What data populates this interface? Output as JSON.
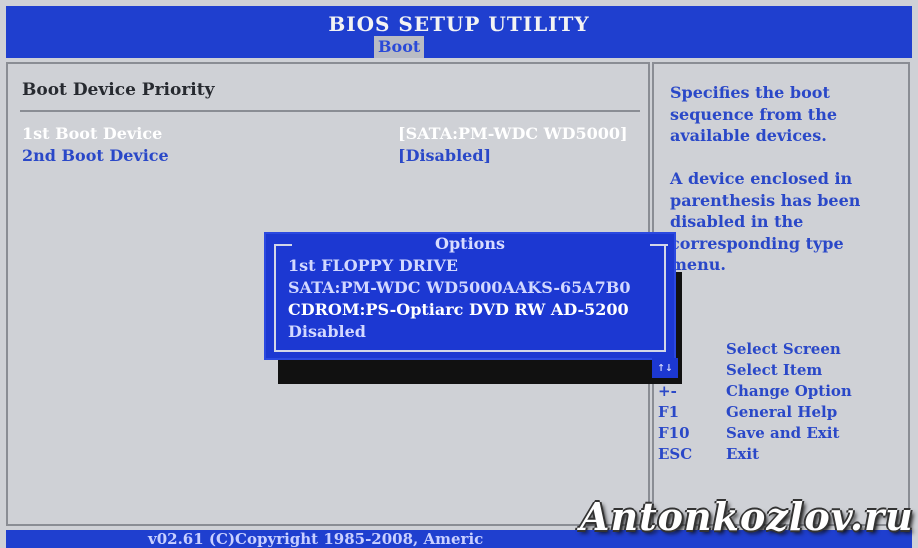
{
  "header": {
    "title": "BIOS SETUP UTILITY",
    "active_tab": "Boot"
  },
  "main": {
    "section_title": "Boot Device Priority",
    "rows": [
      {
        "label": "1st Boot Device",
        "value": "[SATA:PM-WDC WD5000]"
      },
      {
        "label": "2nd Boot Device",
        "value": "[Disabled]"
      }
    ]
  },
  "dialog": {
    "title": "Options",
    "options": [
      "1st FLOPPY DRIVE",
      "SATA:PM-WDC WD5000AAKS-65A7B0",
      "CDROM:PS-Optiarc DVD RW AD-5200",
      "Disabled"
    ],
    "selected_index": 2
  },
  "help": {
    "lines_1": [
      "Specifies the boot",
      "sequence from the",
      "available devices."
    ],
    "lines_2": [
      "A device enclosed in",
      "parenthesis has been",
      "disabled in the",
      "corresponding type",
      "menu."
    ],
    "keys": [
      {
        "key": "",
        "desc": "Select Screen"
      },
      {
        "key": "↑↓",
        "desc": "Select Item"
      },
      {
        "key": "+-",
        "desc": "Change Option"
      },
      {
        "key": "F1",
        "desc": "General Help"
      },
      {
        "key": "F10",
        "desc": "Save and Exit"
      },
      {
        "key": "ESC",
        "desc": "Exit"
      }
    ]
  },
  "footer": {
    "text": "v02.61 (C)Copyright 1985-2008, Americ"
  },
  "watermark": {
    "text": "Antonkozlov.ru"
  },
  "colors": {
    "bios_blue": "#1f3fcf",
    "panel_gray": "#cfd1d6",
    "text_blue": "#2a48c8"
  }
}
